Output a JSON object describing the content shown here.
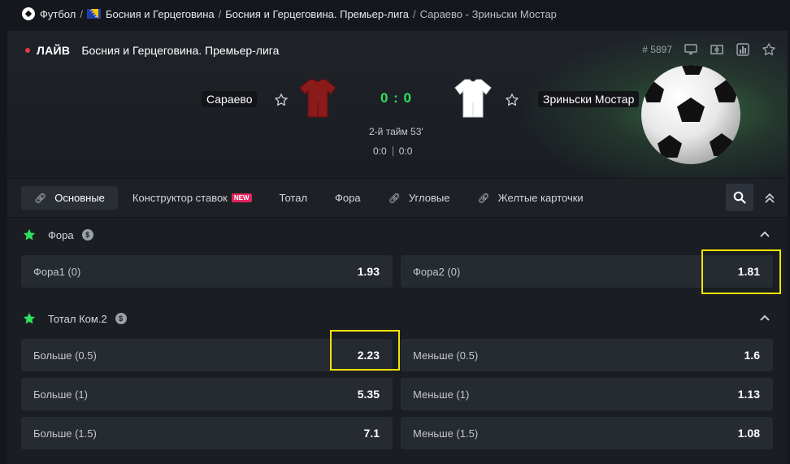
{
  "breadcrumb": {
    "items": [
      "Футбол",
      "Босния и Герцеговина",
      "Босния и Герцеговина. Премьер-лига",
      "Сараево - Зриньски Мостар"
    ],
    "separator": "/"
  },
  "header": {
    "live_label": "ЛАЙВ",
    "league": "Босния и Герцеговина. Премьер-лига",
    "match_id": "# 5897",
    "home_team": "Сараево",
    "away_team": "Зриньски Мостар",
    "score": "0 : 0",
    "period": "2-й тайм 53'",
    "sub_score_1": "0:0",
    "sub_score_2": "0:0",
    "icons": [
      "tv-icon",
      "field-icon",
      "stats-icon",
      "star-icon"
    ],
    "colors": {
      "live_dot": "#e43b3b",
      "score": "#2ee05a",
      "home_kit": "#8b1a1a",
      "away_kit": "#ffffff"
    }
  },
  "tabs": [
    {
      "label": "Основные",
      "icon": "link-icon",
      "active": true
    },
    {
      "label": "Конструктор ставок",
      "badge": "NEW"
    },
    {
      "label": "Тотал"
    },
    {
      "label": "Фора"
    },
    {
      "label": "Угловые",
      "icon": "link-icon"
    },
    {
      "label": "Желтые карточки",
      "icon": "link-icon"
    }
  ],
  "markets": [
    {
      "title": "Фора",
      "odds": [
        {
          "name": "Фора1 (0)",
          "value": "1.93"
        },
        {
          "name": "Фора2 (0)",
          "value": "1.81",
          "highlighted": true
        }
      ]
    },
    {
      "title": "Тотал Ком.2",
      "odds": [
        {
          "name": "Больше (0.5)",
          "value": "2.23",
          "highlighted": true
        },
        {
          "name": "Меньше (0.5)",
          "value": "1.6"
        },
        {
          "name": "Больше (1)",
          "value": "5.35"
        },
        {
          "name": "Меньше (1)",
          "value": "1.13"
        },
        {
          "name": "Больше (1.5)",
          "value": "7.1"
        },
        {
          "name": "Меньше (1.5)",
          "value": "1.08"
        }
      ]
    }
  ],
  "highlight_color": "#f2e500",
  "accent_color": "#2ee05a"
}
